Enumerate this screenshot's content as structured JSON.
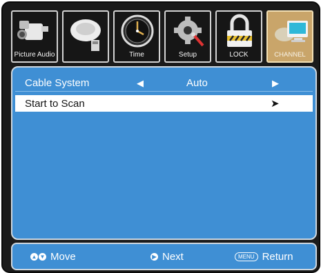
{
  "tabs": [
    {
      "label": "Picture Audio",
      "icon": "camera-icon"
    },
    {
      "label": "",
      "icon": "satellite-dish-icon"
    },
    {
      "label": "Time",
      "icon": "clock-icon"
    },
    {
      "label": "Setup",
      "icon": "gear-icon"
    },
    {
      "label": "LOCK",
      "icon": "lock-icon"
    },
    {
      "label": "CHANNEL",
      "icon": "tv-channel-icon",
      "active": true
    }
  ],
  "menu": {
    "cable_system": {
      "label": "Cable System",
      "value": "Auto",
      "left_arrow": "◀",
      "right_arrow": "▶"
    },
    "start_scan": {
      "label": "Start to Scan",
      "arrow": "➤"
    }
  },
  "footer": {
    "move_label": "Move",
    "next_label": "Next",
    "menu_key": "MENU",
    "return_label": "Return"
  },
  "colors": {
    "panel": "#3f8fd4",
    "active_tab": "#c9a56a",
    "frame": "#1b1b1b"
  }
}
